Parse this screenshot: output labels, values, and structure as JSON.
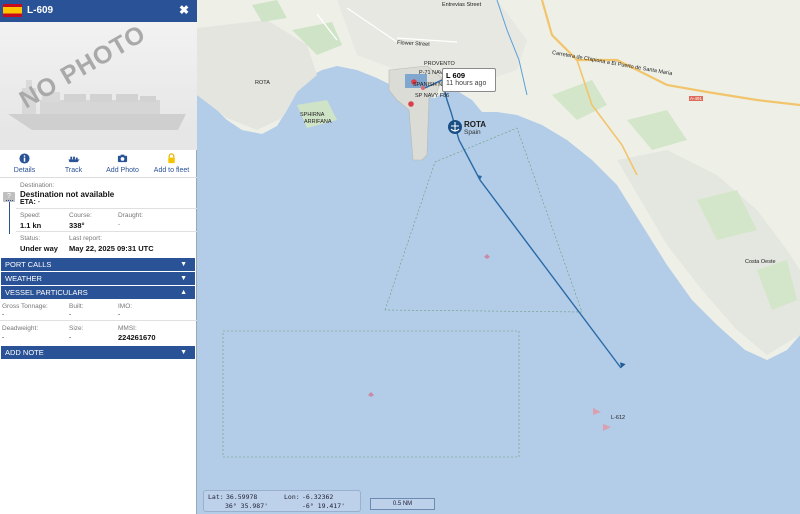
{
  "vessel": {
    "name": "L-609",
    "close_icon": "close-icon",
    "no_photo_text": "NO PHOTO"
  },
  "actions": [
    {
      "label": "Details",
      "icon": "info-icon"
    },
    {
      "label": "Track",
      "icon": "ship-icon"
    },
    {
      "label": "Add Photo",
      "icon": "camera-icon"
    },
    {
      "label": "Add to fleet",
      "icon": "lock-icon"
    }
  ],
  "voyage": {
    "destination_label": "Destination:",
    "destination_value": "Destination not available",
    "eta_label": "ETA:",
    "eta_value": "-",
    "unknown_port_badge": "?",
    "speed_label": "Speed:",
    "speed_value": "1.1 kn",
    "course_label": "Course:",
    "course_value": "338°",
    "draught_label": "Draught:",
    "draught_value": "-",
    "status_label": "Status:",
    "status_value": "Under way",
    "last_report_label": "Last report:",
    "last_report_value": "May 22, 2025 09:31 UTC"
  },
  "sections": {
    "port_calls": "PORT CALLS",
    "weather": "WEATHER",
    "vessel_particulars": "VESSEL PARTICULARS",
    "add_note": "ADD NOTE"
  },
  "particulars": {
    "gross_tonnage_label": "Gross Tonnage:",
    "gross_tonnage_value": "-",
    "built_label": "Built:",
    "built_value": "-",
    "imo_label": "IMO:",
    "imo_value": "-",
    "deadweight_label": "Deadweight:",
    "deadweight_value": "-",
    "size_label": "Size:",
    "size_value": "-",
    "mmsi_label": "MMSI:",
    "mmsi_value": "224261670"
  },
  "map": {
    "tooltip_name": "L 609",
    "tooltip_time": "11 hours ago",
    "port_name": "ROTA",
    "port_country": "Spain",
    "labels": {
      "rota_town": "ROTA",
      "sphirna": "SPHIRNA",
      "arrifana": "ARRIFANA",
      "provento": "PROVENTO",
      "p71": "P-71 NAVY",
      "spanish_navy": "SPANISH NAV",
      "sp_navy": "SP NAVY F86",
      "l612": "L-612",
      "costa_oeste": "Costa Oeste",
      "flower_street": "Flower Street",
      "entrevias": "Entrevias Street",
      "carretera": "Carretera de Chipiona a El Puerto de Santa María",
      "a491": "A-491"
    },
    "coords": {
      "lat_label": "Lat:",
      "lat_decimal": "36.59978",
      "lat_dms": "36° 35.987'",
      "lon_label": "Lon:",
      "lon_decimal": "-6.32362",
      "lon_dms": "-6° 19.417'"
    },
    "scale": "0.5 NM",
    "colors": {
      "sea": "#b3cde8",
      "land": "#eef0e8",
      "track": "#2a6aa6",
      "header": "#2a5296"
    }
  }
}
